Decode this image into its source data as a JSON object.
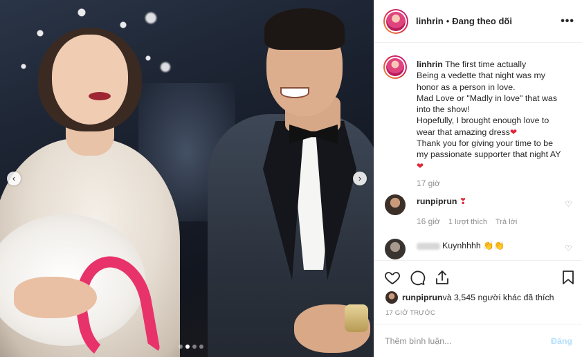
{
  "header": {
    "username": "linhrin",
    "separator": "•",
    "follow_status": "Đang theo dõi",
    "more_icon": "•••"
  },
  "photo": {
    "prev_arrow": "‹",
    "next_arrow": "›",
    "dots_total": 4,
    "dots_active_index": 1
  },
  "caption": {
    "username": "linhrin",
    "lines": [
      "The first time actually",
      "Being a vedette that night was my",
      "honor as a person in love.",
      "Mad Love or \"Madly in love\" that was",
      "into the show!",
      "Hopefully, I brought enough love to",
      "wear that amazing dress",
      "Thank you for giving your time to be",
      "my passionate supporter that night AY",
      ""
    ],
    "heart": "❤",
    "time": "17 giờ"
  },
  "comments": [
    {
      "username": "runpiprun",
      "text": "❣",
      "time": "16 giờ",
      "likes": "1 lượt thích",
      "reply": "Trả lời"
    },
    {
      "username": "",
      "text": "Kuynhhhh 👏👏"
    }
  ],
  "actions": {
    "like_icon": "heart-outline-icon",
    "comment_icon": "comment-icon",
    "share_icon": "share-icon",
    "save_icon": "bookmark-icon"
  },
  "likes": {
    "first_liker": "runpiprun",
    "rest": " và 3,545 người khác đã thích"
  },
  "post_time": "17 GIỜ TRƯỚC",
  "add_comment": {
    "placeholder": "Thêm bình luận...",
    "post_label": "Đăng"
  },
  "colors": {
    "accent_blue_disabled": "#b2dffc",
    "heart_red": "#e02638",
    "muted_text": "#8e8e8e"
  }
}
